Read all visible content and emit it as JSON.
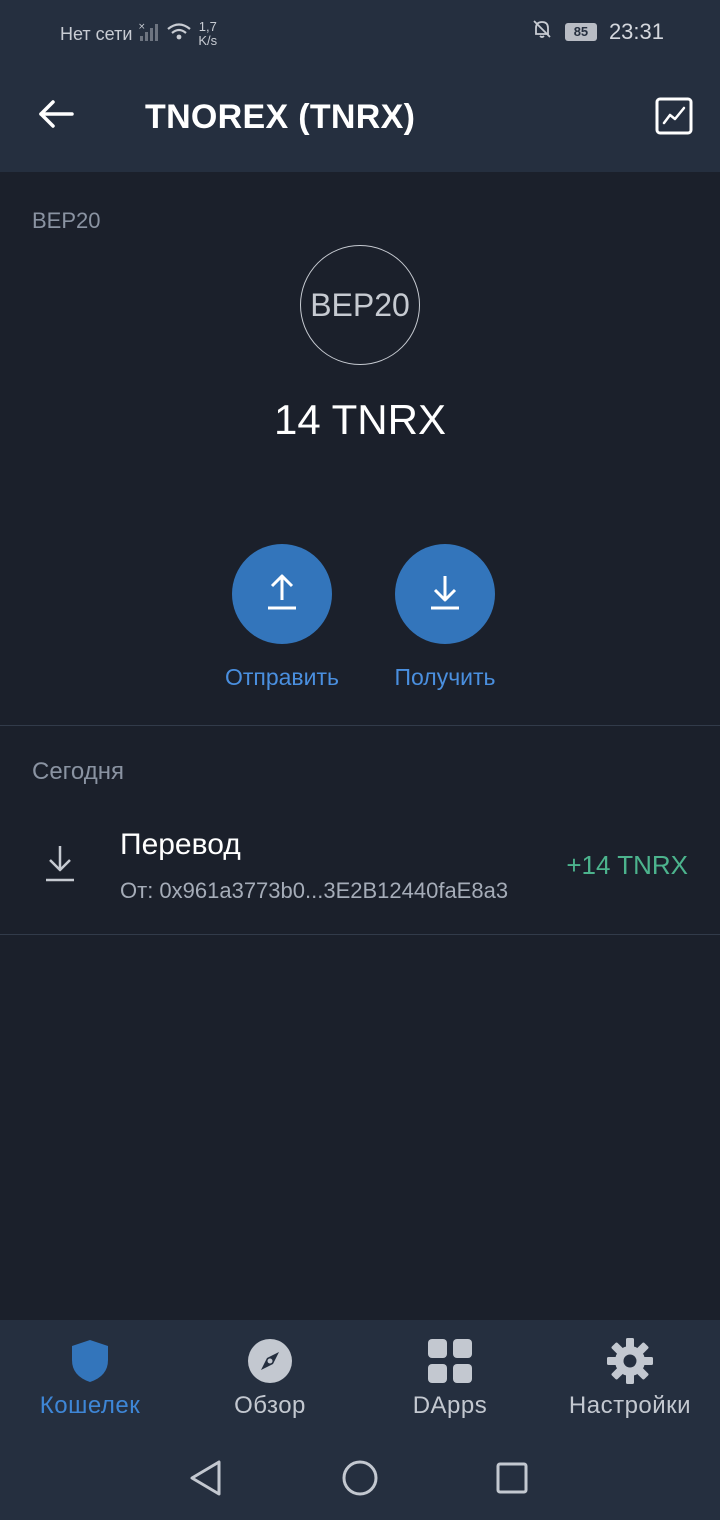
{
  "status_bar": {
    "carrier": "Нет сети",
    "net_speed_value": "1,7",
    "net_speed_unit": "K/s",
    "battery": "85",
    "time": "23:31"
  },
  "header": {
    "title": "TNOREX (TNRX)"
  },
  "token": {
    "network": "BEP20",
    "logo_text": "BEP20",
    "balance": "14 TNRX"
  },
  "actions": {
    "send_label": "Отправить",
    "receive_label": "Получить"
  },
  "transactions": {
    "date_header": "Сегодня",
    "items": [
      {
        "title": "Перевод",
        "address": "От: 0x961a3773b0...3E2B12440faE8a3",
        "amount": "+14 TNRX"
      }
    ]
  },
  "bottom_nav": {
    "items": [
      {
        "label": "Кошелек",
        "icon": "shield-icon",
        "active": true
      },
      {
        "label": "Обзор",
        "icon": "compass-icon",
        "active": false
      },
      {
        "label": "DApps",
        "icon": "grid-icon",
        "active": false
      },
      {
        "label": "Настройки",
        "icon": "gear-icon",
        "active": false
      }
    ]
  },
  "colors": {
    "background": "#1b202b",
    "bar": "#252f3f",
    "accent": "#3375bb",
    "positive": "#4cb38d"
  }
}
